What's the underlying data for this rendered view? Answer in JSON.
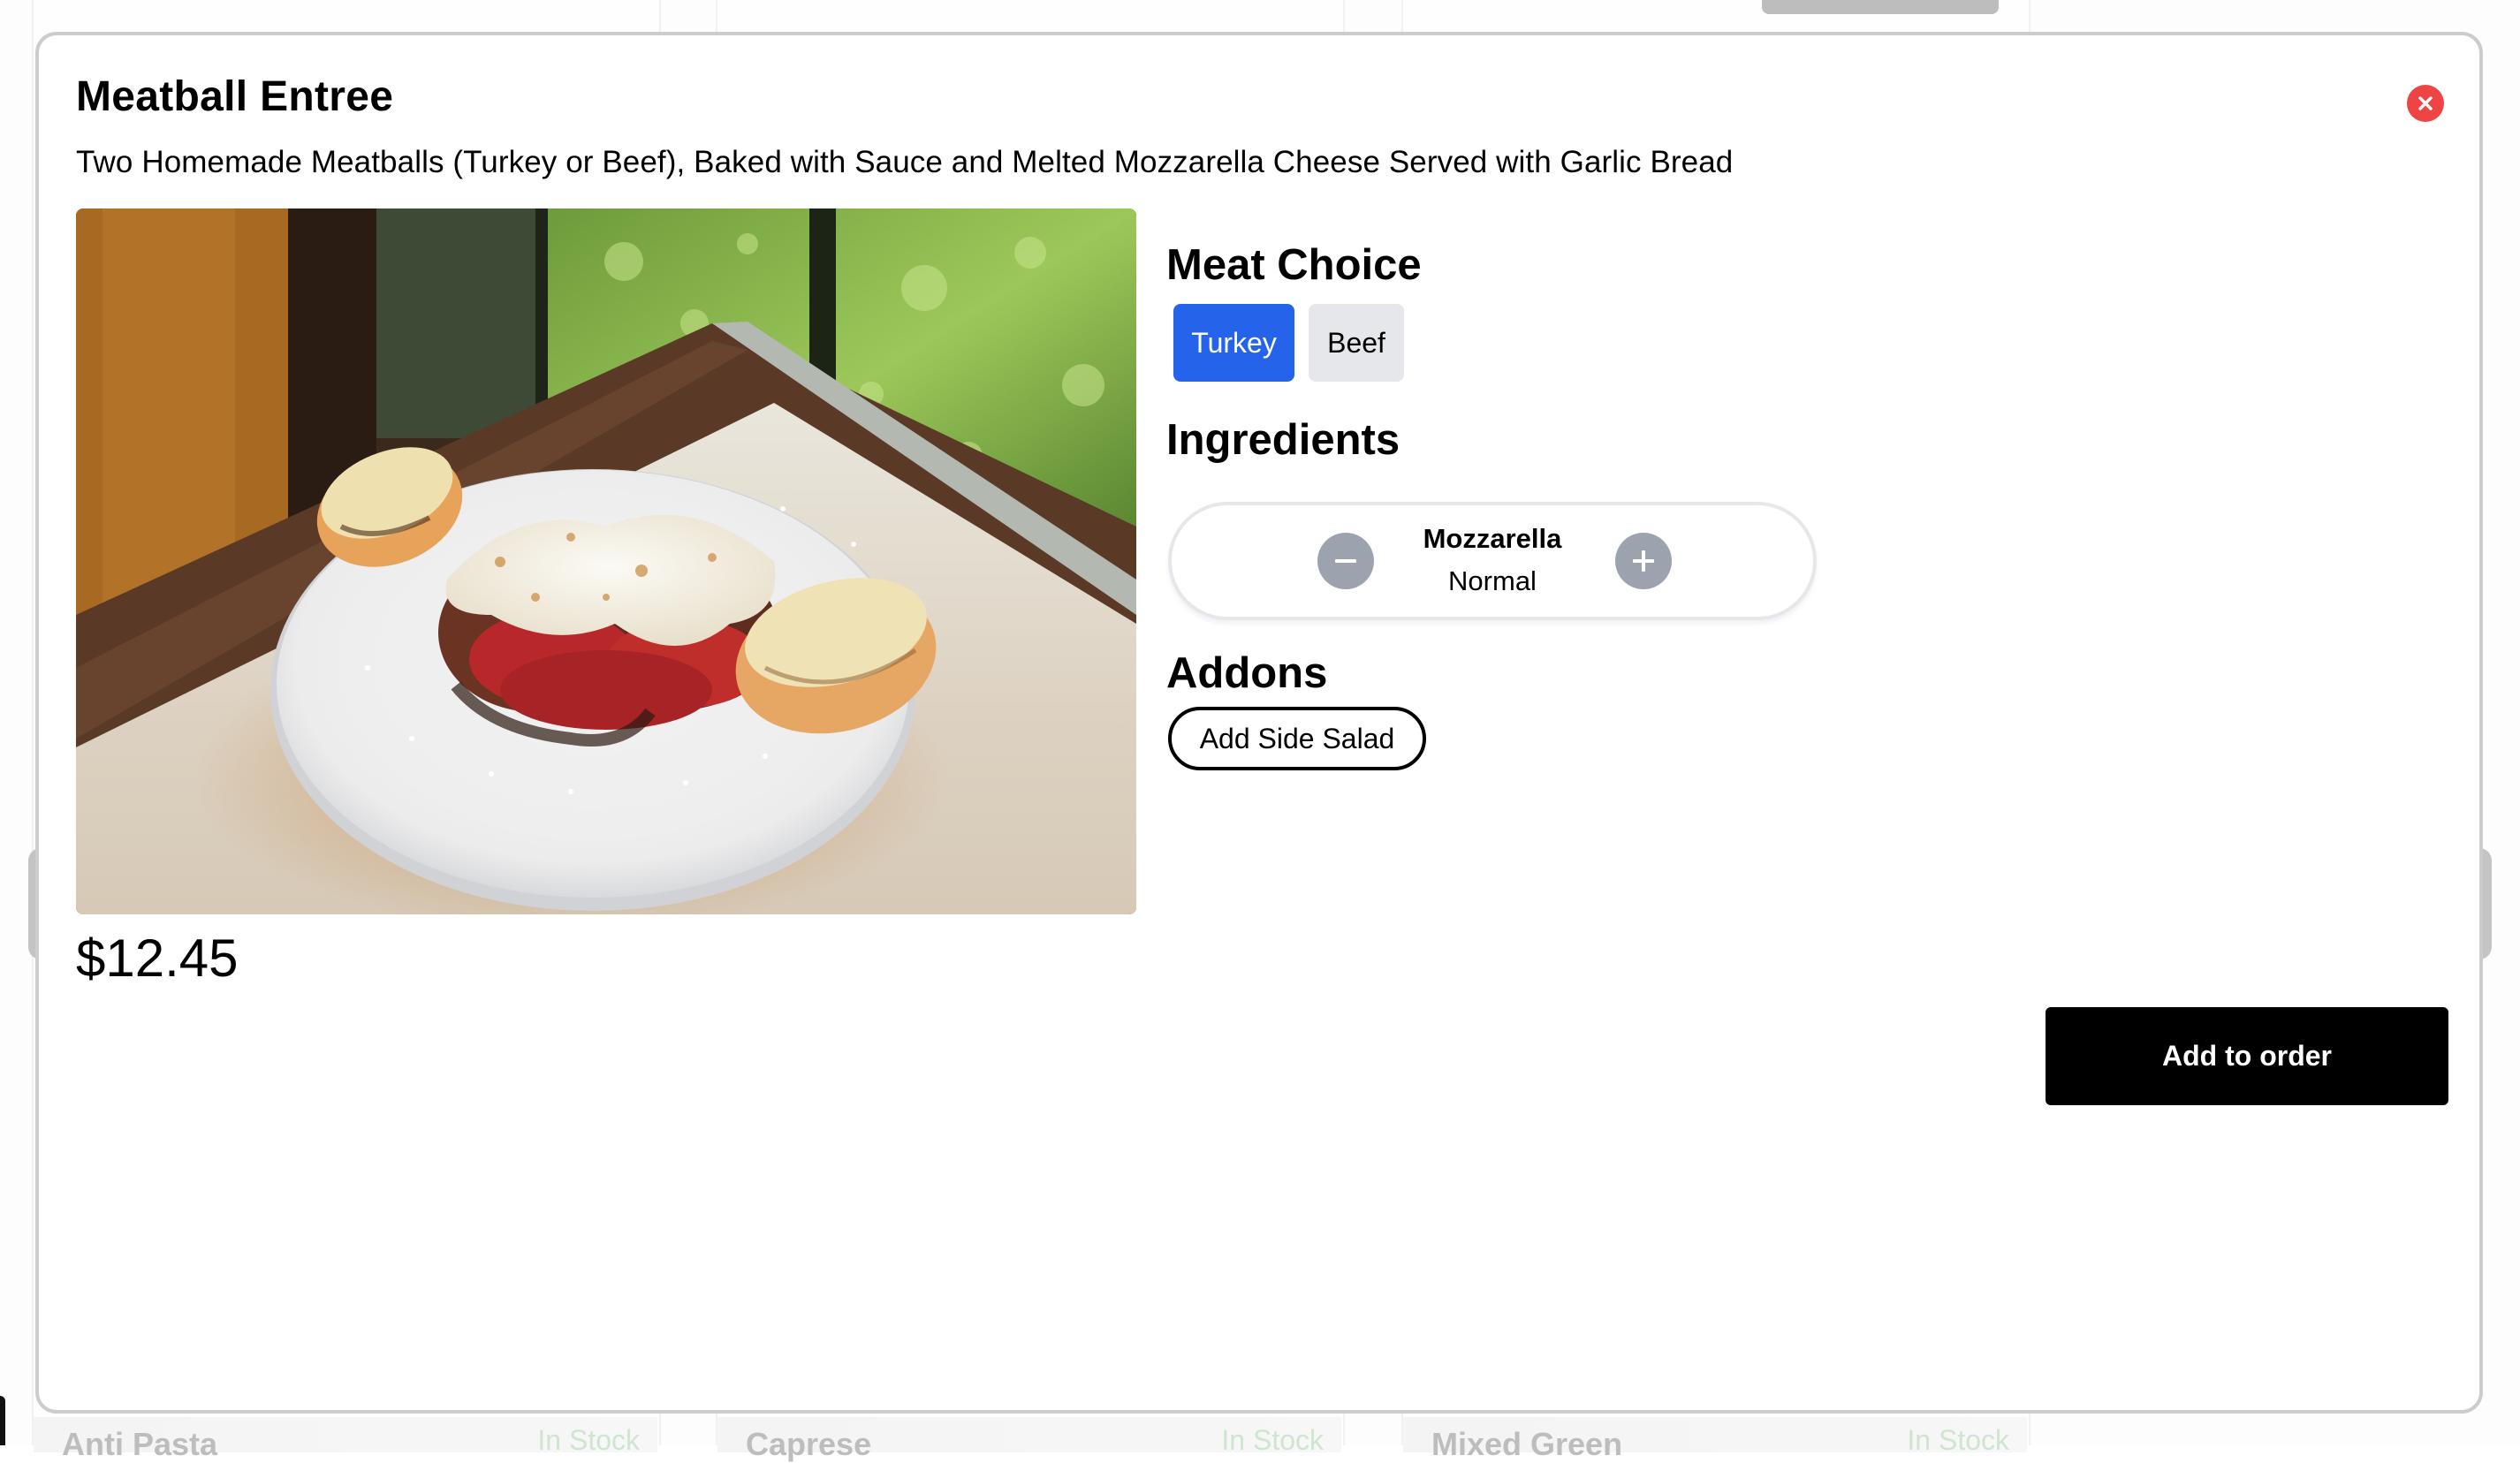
{
  "background": {
    "cards": [
      {
        "name": "Anti Pasta",
        "stock": "In Stock"
      },
      {
        "name": "Caprese",
        "stock": "In Stock"
      },
      {
        "name": "Mixed Green",
        "stock": "In Stock"
      }
    ]
  },
  "modal": {
    "title": "Meatball Entree",
    "description": "Two Homemade Meatballs (Turkey or Beef), Baked with Sauce and Melted Mozzarella Cheese Served with Garlic Bread",
    "close_icon": "close-circle-icon",
    "photo_alt": "Meatballs with sauce and melted mozzarella on a white plate with garlic bread",
    "price": "$12.45",
    "meat_choice": {
      "title": "Meat Choice",
      "options": [
        {
          "label": "Turkey",
          "selected": true
        },
        {
          "label": "Beef",
          "selected": false
        }
      ]
    },
    "ingredients": {
      "title": "Ingredients",
      "items": [
        {
          "name": "Mozzarella",
          "level": "Normal",
          "decrease_icon": "minus-icon",
          "increase_icon": "plus-icon"
        }
      ]
    },
    "addons": {
      "title": "Addons",
      "items": [
        {
          "label": "Add Side Salad"
        }
      ]
    },
    "add_to_order_label": "Add to order"
  },
  "colors": {
    "selected_choice": "#2563eb",
    "unselected_choice": "#e5e7eb",
    "close_button": "#ef4444",
    "stepper_button": "#9ca3af",
    "primary_action": "#000000",
    "in_stock_text": "#cfe5cf"
  }
}
